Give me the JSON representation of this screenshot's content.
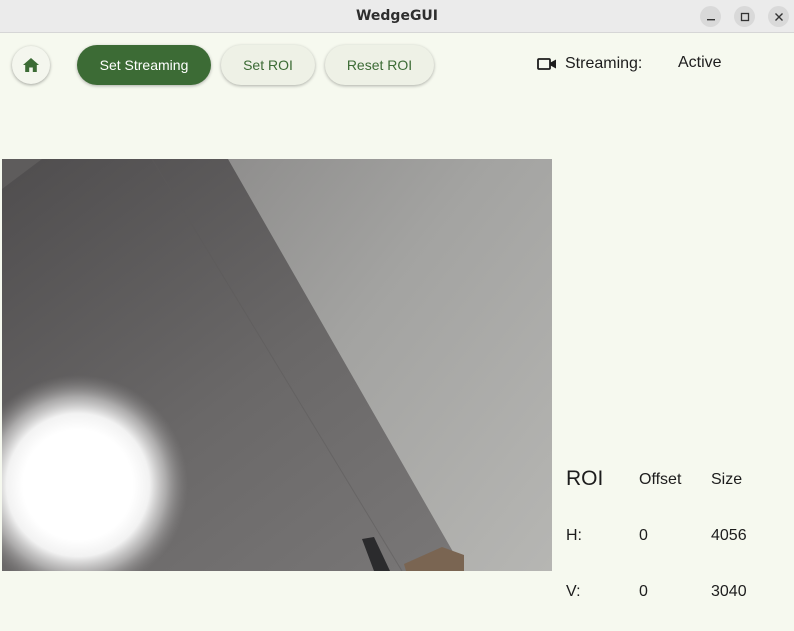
{
  "window": {
    "title": "WedgeGUI"
  },
  "toolbar": {
    "set_streaming_label": "Set Streaming",
    "set_roi_label": "Set ROI",
    "reset_roi_label": "Reset ROI"
  },
  "status": {
    "label": "Streaming:",
    "value": "Active"
  },
  "roi": {
    "title": "ROI",
    "offset_header": "Offset",
    "size_header": "Size",
    "rows": [
      {
        "label": "H:",
        "offset": "0",
        "size": "4056"
      },
      {
        "label": "V:",
        "offset": "0",
        "size": "3040"
      }
    ]
  },
  "colors": {
    "accent": "#3c6b35",
    "background": "#f6f9ef",
    "titlebar": "#ebebeb"
  },
  "icons": {
    "home": "home-icon",
    "camera": "video-camera-icon",
    "minimize": "minimize-icon",
    "maximize": "maximize-icon",
    "close": "close-icon"
  }
}
